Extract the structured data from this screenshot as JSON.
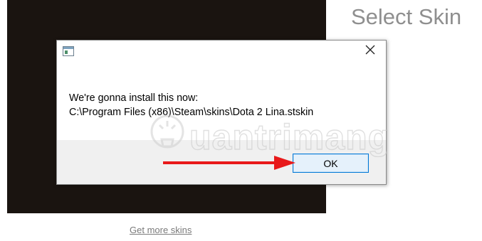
{
  "page": {
    "title": "Select Skin",
    "more_link": "Get more skins"
  },
  "dialog": {
    "app_icon": "window-app-icon",
    "close_icon": "close-icon",
    "message_line1": "We're gonna install this now:",
    "message_line2": "C:\\Program Files (x86)\\Steam\\skins\\Dota 2 Lina.stskin",
    "ok_label": "OK",
    "accent_color": "#0078d7"
  },
  "overlay": {
    "arrow_color": "#e8191a",
    "watermark_text": "uantrimang",
    "watermark_icon": "lightbulb-icon"
  }
}
